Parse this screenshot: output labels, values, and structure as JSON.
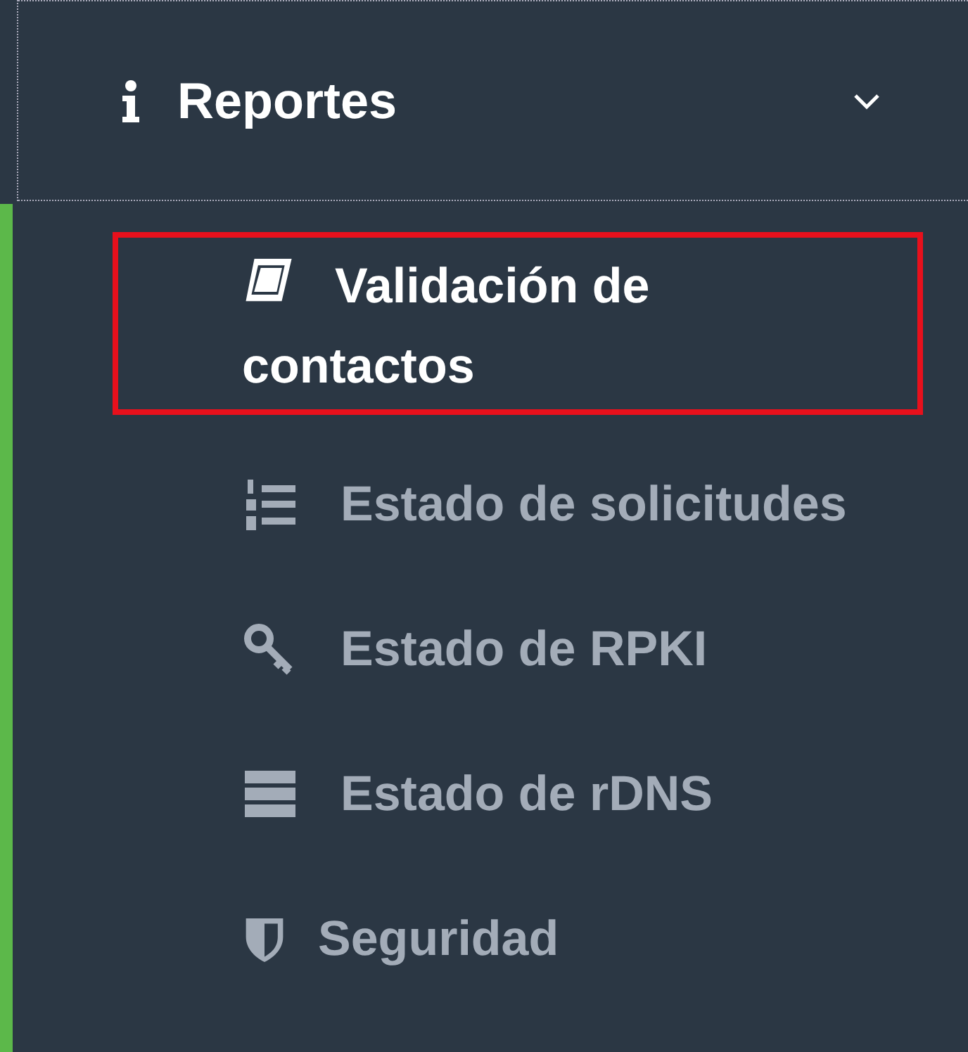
{
  "menu": {
    "label": "Reportes",
    "expanded": true,
    "items": [
      {
        "label": "Validación de contactos",
        "selected": true
      },
      {
        "label": "Estado de solicitudes",
        "selected": false
      },
      {
        "label": "Estado de RPKI",
        "selected": false
      },
      {
        "label": "Estado de rDNS",
        "selected": false
      },
      {
        "label": "Seguridad",
        "selected": false
      }
    ]
  }
}
